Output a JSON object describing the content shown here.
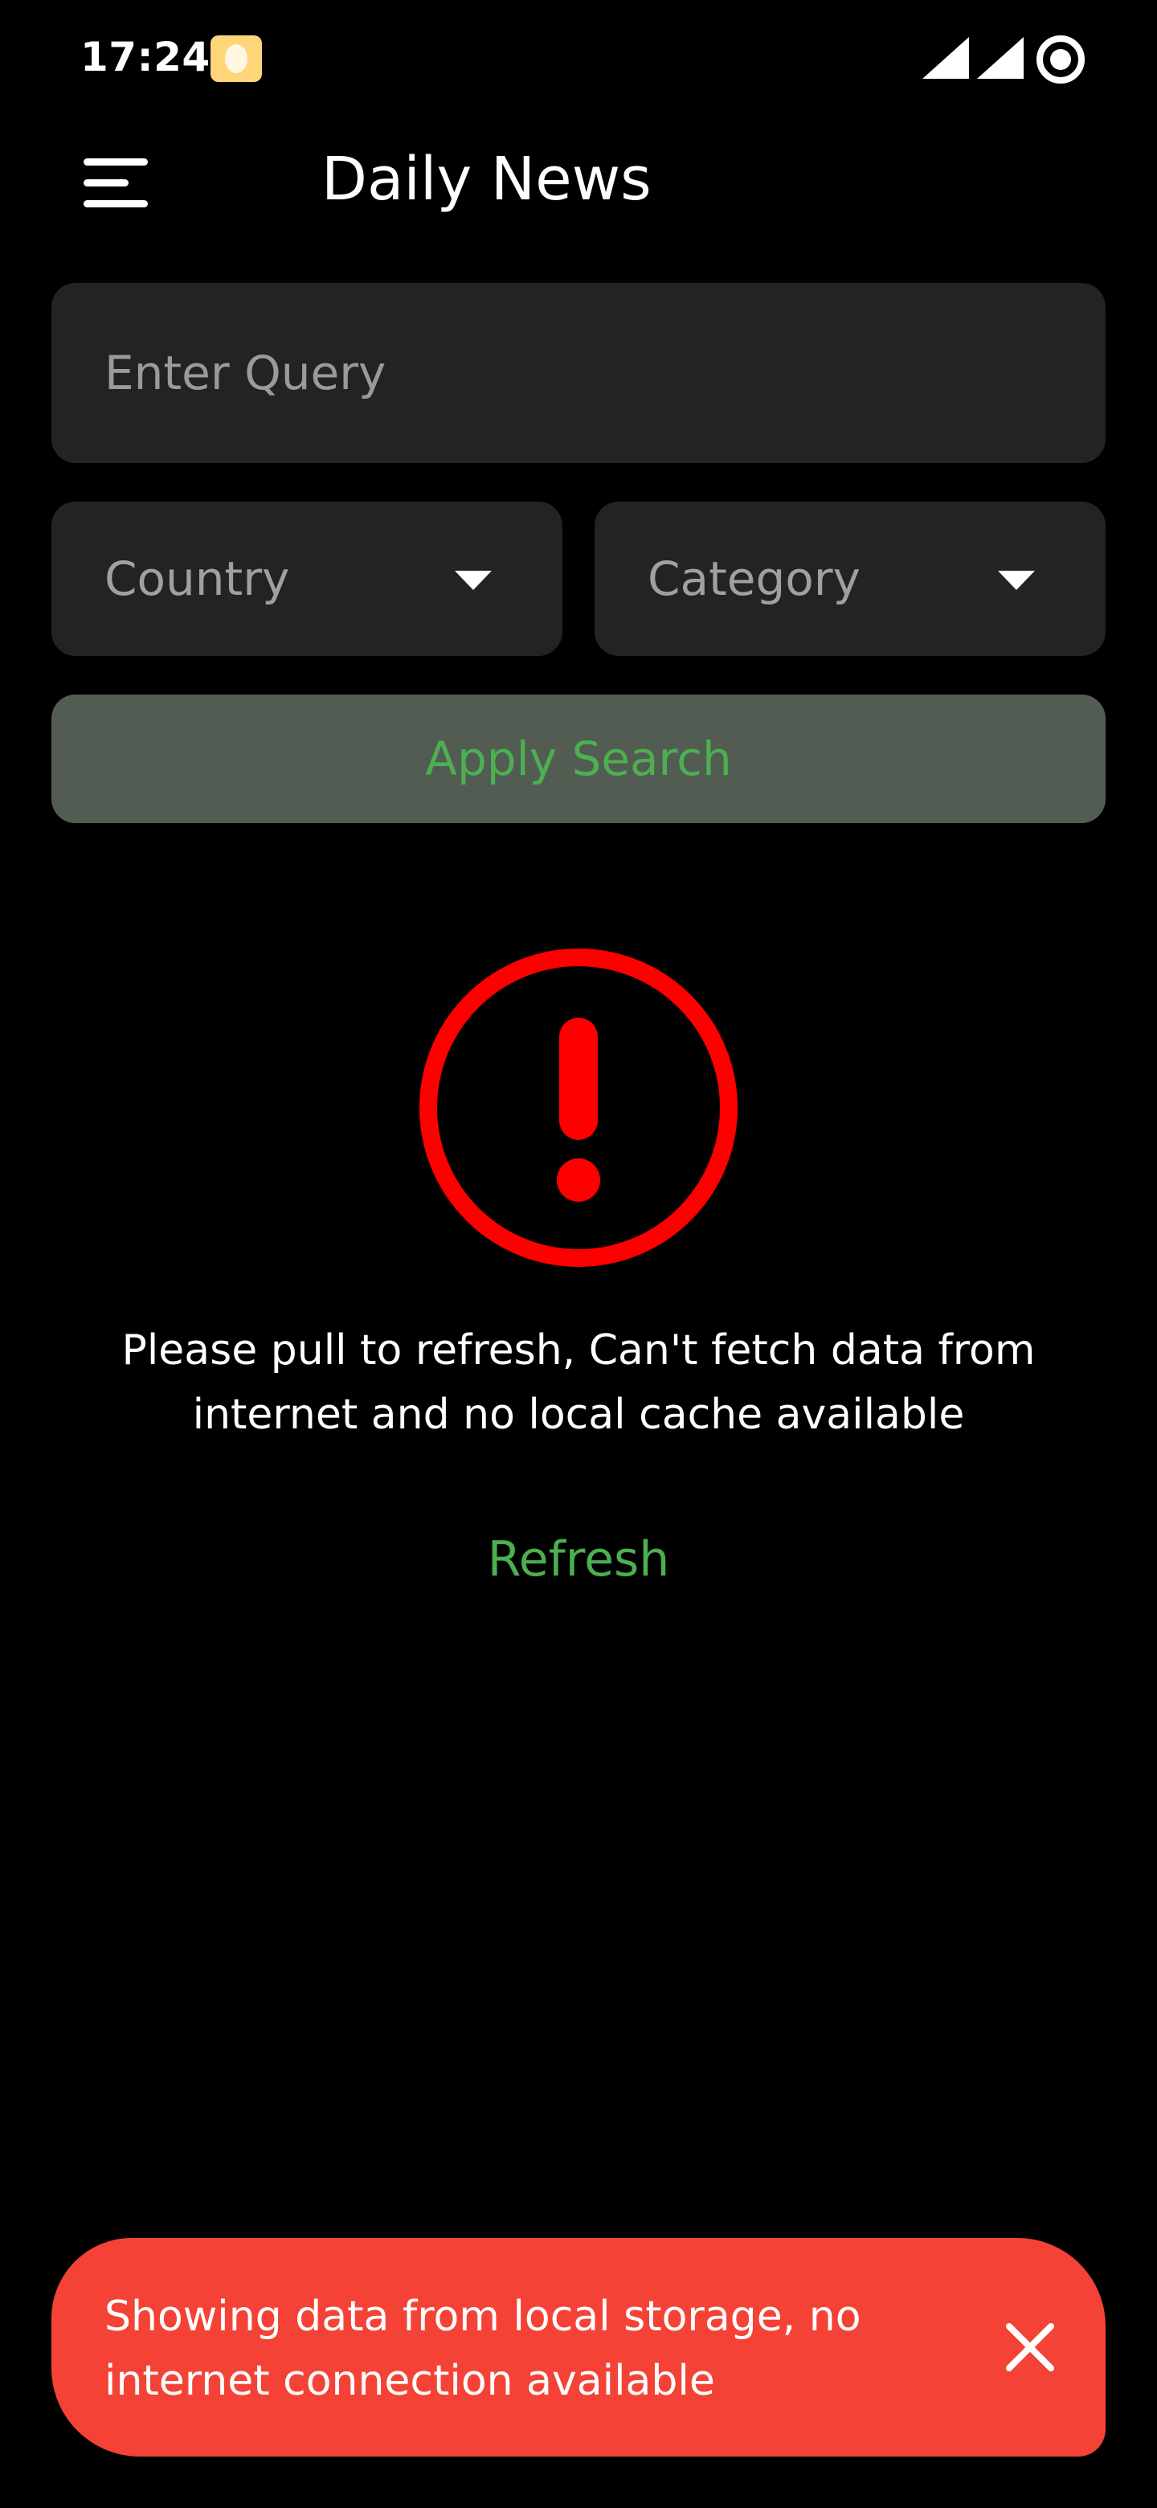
{
  "status_bar": {
    "time": "17:24",
    "icons": [
      "notification-icon",
      "cell-signal-icon",
      "cell-signal-icon",
      "data-saver-icon"
    ]
  },
  "app_bar": {
    "title": "Daily News",
    "menu_icon": "hamburger-menu-icon"
  },
  "search": {
    "query_placeholder": "Enter Query",
    "query_value": "",
    "country_label": "Country",
    "category_label": "Category",
    "apply_label": "Apply Search"
  },
  "error_state": {
    "icon": "error-alert-icon",
    "message": "Please pull to refresh, Can't fetch data from internet and no local cache available",
    "refresh_label": "Refresh"
  },
  "snackbar": {
    "message": "Showing data from local storage, no internet connection available",
    "close_icon": "close-icon"
  },
  "colors": {
    "background": "#000000",
    "surface": "#232323",
    "accent_green": "#4caf50",
    "button_disabled_bg": "#525c52",
    "error_red": "#ff0000",
    "snackbar_bg": "#f44336",
    "notification_yellow": "#ffd57a"
  }
}
